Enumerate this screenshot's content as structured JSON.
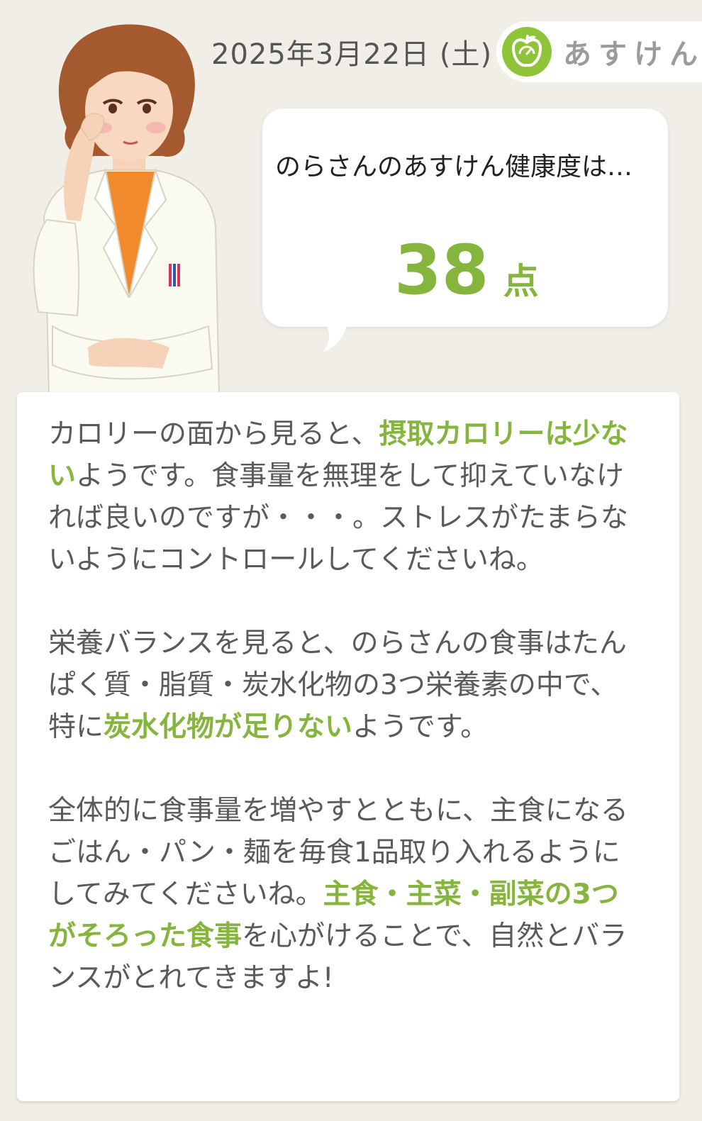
{
  "header": {
    "date": "2025年3月22日 (土)",
    "brand_name": "あすけん"
  },
  "bubble": {
    "message": "のらさんのあすけん健康度は…",
    "score": "38",
    "score_unit": "点"
  },
  "advice": {
    "p1": {
      "t1": "カロリーの面から見ると、",
      "h1": "摂取カロリーは少ない",
      "t2": "ようです。食事量を無理をして抑えていなければ良いのですが・・・。ストレスがたまらないようにコントロールしてくださいね。"
    },
    "p2": {
      "t1": "栄養バランスを見ると、のらさんの食事はたんぱく質・脂質・炭水化物の3つ栄養素の中で、特に",
      "h1": "炭水化物が足りない",
      "t2": "ようです。"
    },
    "p3": {
      "t1": "全体的に食事量を増やすとともに、主食になるごはん・パン・麺を毎食1品取り入れるようにしてみてくださいね。",
      "h1": "主食・主菜・副菜の3つがそろった食事",
      "t2": "を心がけることで、自然とバランスがとれてきますよ!"
    }
  },
  "colors": {
    "accent": "#86b53d",
    "background": "#f0eee7"
  },
  "icons": {
    "brand": "apple-scale-icon"
  },
  "illustration": "doctor-avatar"
}
